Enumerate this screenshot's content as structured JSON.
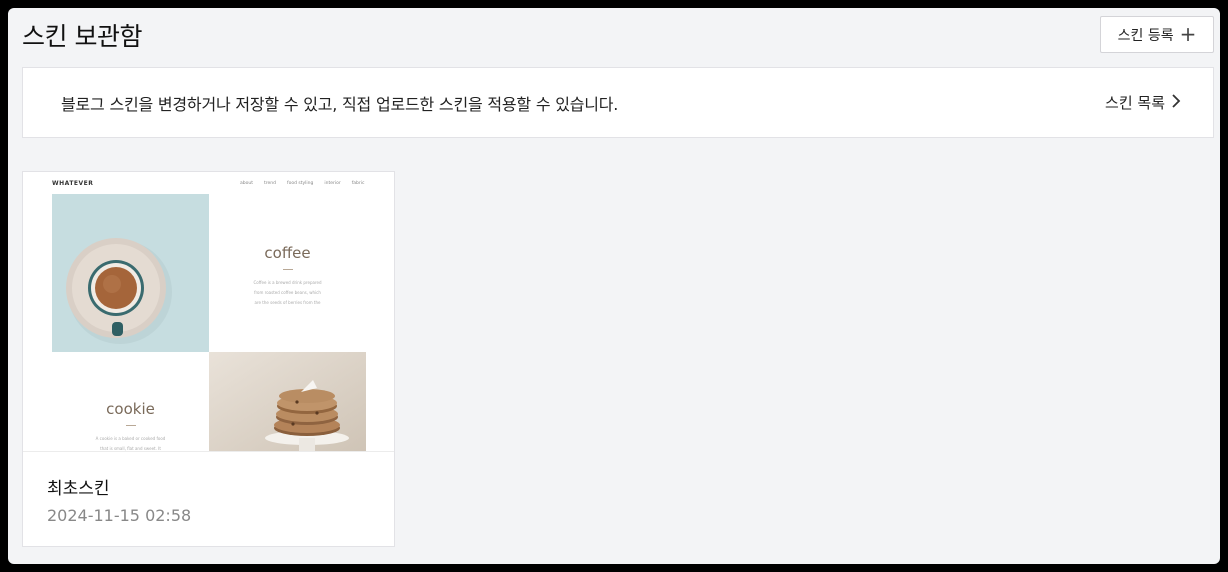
{
  "header": {
    "title": "스킨 보관함",
    "register_label": "스킨 등록",
    "register_icon": "plus-icon"
  },
  "banner": {
    "text": "블로그 스킨을 변경하거나 저장할 수 있고, 직접 업로드한 스킨을 적용할 수 있습니다.",
    "link_label": "스킨 목록",
    "link_icon": "chevron-right-icon"
  },
  "skins": [
    {
      "name": "최초스킨",
      "date": "2024-11-15 02:58",
      "preview": {
        "logo": "WHATEVER",
        "nav": [
          "about",
          "trend",
          "food styling",
          "interior",
          "fabric"
        ],
        "sections": [
          {
            "heading": "coffee",
            "lines": [
              "Coffee is a brewed drink prepared",
              "from roasted coffee beans, which",
              "are the seeds of berries from the"
            ]
          },
          {
            "heading": "cookie",
            "lines": [
              "A cookie is a baked or cooked food",
              "that is small, flat and sweet. It"
            ]
          }
        ]
      }
    }
  ]
}
